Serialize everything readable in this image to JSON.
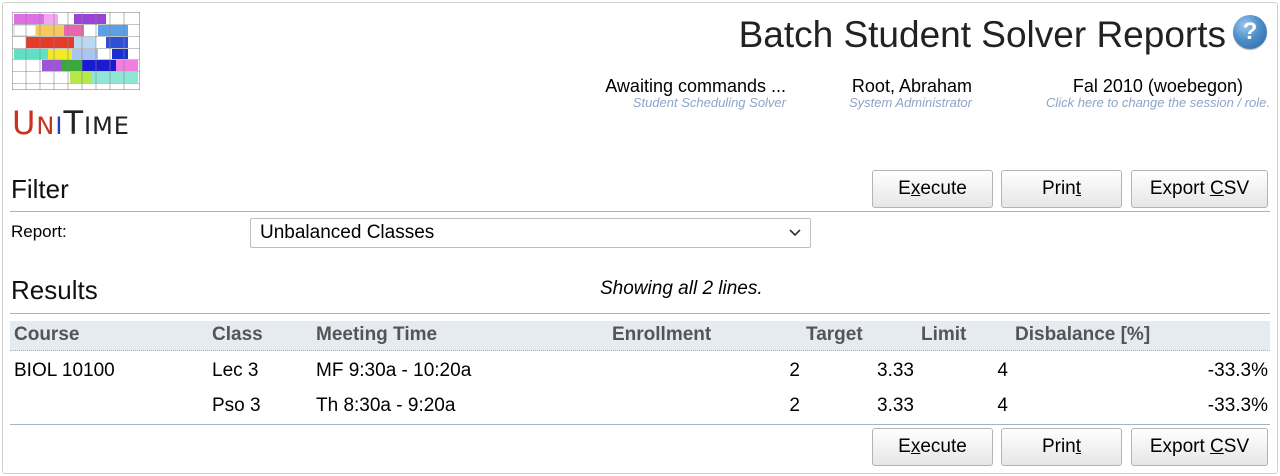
{
  "app": {
    "logo_text": "UniTime",
    "page_title": "Batch Student Solver Reports",
    "help_label": "?"
  },
  "header": {
    "status": {
      "main": "Awaiting commands ...",
      "sub": "Student Scheduling Solver"
    },
    "user": {
      "main": "Root, Abraham",
      "sub": "System Administrator"
    },
    "session": {
      "main": "Fal 2010 (woebegon)",
      "sub": "Click here to change the session / role."
    }
  },
  "filter": {
    "title": "Filter",
    "report_label": "Report:",
    "report_value": "Unbalanced Classes"
  },
  "buttons": {
    "execute": {
      "pre": "E",
      "acc": "x",
      "post": "ecute"
    },
    "print": {
      "pre": "Prin",
      "acc": "t",
      "post": ""
    },
    "export": {
      "pre": "Export ",
      "acc": "C",
      "post": "SV"
    }
  },
  "results": {
    "title": "Results",
    "message": "Showing all 2 lines.",
    "columns": [
      "Course",
      "Class",
      "Meeting Time",
      "Enrollment",
      "Target",
      "Limit",
      "Disbalance [%]"
    ],
    "rows": [
      {
        "course": "BIOL 10100",
        "class": "Lec 3",
        "time": "MF 9:30a - 10:20a",
        "enrollment": "2",
        "target": "3.33",
        "limit": "4",
        "disbalance": "-33.3%"
      },
      {
        "course": "",
        "class": "Pso 3",
        "time": "Th 8:30a - 9:20a",
        "enrollment": "2",
        "target": "3.33",
        "limit": "4",
        "disbalance": "-33.3%"
      }
    ]
  }
}
